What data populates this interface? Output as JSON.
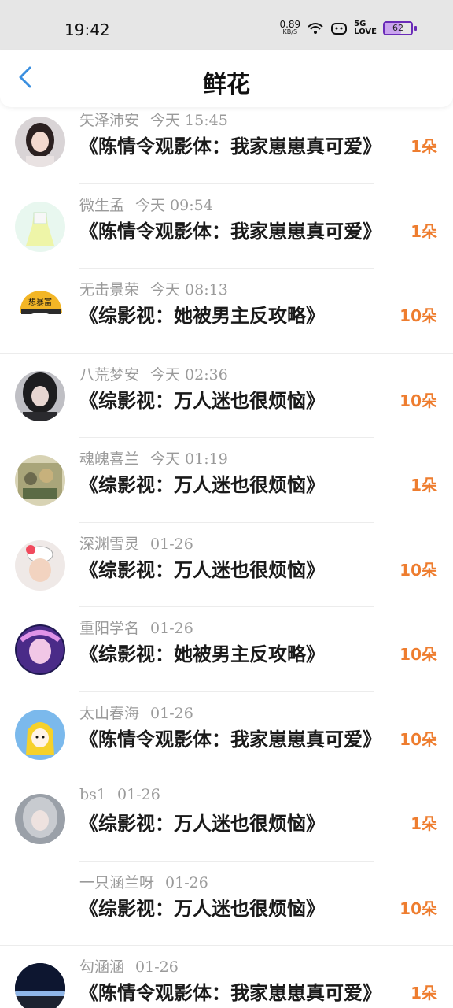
{
  "status_bar": {
    "time": "19:42",
    "net_speed_value": "0.89",
    "net_speed_unit": "KB/S",
    "network_top": "5G",
    "network_bottom": "LOVE",
    "battery": "62",
    "battery_level": 0.62,
    "battery_color": "#6a2bb8"
  },
  "header": {
    "back_icon": "chevron-left-icon",
    "title": "鲜花",
    "accent": "#3a8fe0"
  },
  "list": {
    "count_color": "#ee7d2f",
    "items": [
      {
        "name": "矢泽沛安",
        "time": "今天 15:45",
        "title": "《陈情令观影体：我家崽崽真可爱》",
        "count": "1朵",
        "avatar": "girl-portrait"
      },
      {
        "name": "微生孟",
        "time": "今天 09:54",
        "title": "《陈情令观影体：我家崽崽真可爱》",
        "count": "1朵",
        "avatar": "dress-illustration"
      },
      {
        "name": "无击景荣",
        "time": "今天 08:13",
        "title": "《综影视：她被男主反攻略》",
        "count": "10朵",
        "avatar": "helmet-cartoon",
        "avatar_text": "想暴富"
      },
      {
        "name": "八荒梦安",
        "time": "今天 02:36",
        "title": "《综影视：万人迷也很烦恼》",
        "count": "10朵",
        "avatar": "dark-hair-girl"
      },
      {
        "name": "魂魄喜兰",
        "time": "今天 01:19",
        "title": "《综影视：万人迷也很烦恼》",
        "count": "1朵",
        "avatar": "vintage-illustration"
      },
      {
        "name": "深渊雪灵",
        "time": "01-26",
        "title": "《综影视：万人迷也很烦恼》",
        "count": "10朵",
        "avatar": "child-photo"
      },
      {
        "name": "重阳学名",
        "time": "01-26",
        "title": "《综影视：她被男主反攻略》",
        "count": "10朵",
        "avatar": "anime-purple"
      },
      {
        "name": "太山春海",
        "time": "01-26",
        "title": "《陈情令观影体：我家崽崽真可爱》",
        "count": "10朵",
        "avatar": "yellow-raincoat-cartoon"
      },
      {
        "name": "bs1",
        "time": "01-26",
        "title": "《综影视：万人迷也很烦恼》",
        "count": "1朵",
        "avatar": "silver-hair-art"
      },
      {
        "name": "一只涵兰呀",
        "time": "01-26",
        "title": "《综影视：万人迷也很烦恼》",
        "count": "10朵",
        "avatar": "none"
      },
      {
        "name": "勾涵涵",
        "time": "01-26",
        "title": "《陈情令观影体：我家崽崽真可爱》",
        "count": "1朵",
        "avatar": "night-landscape"
      }
    ]
  }
}
